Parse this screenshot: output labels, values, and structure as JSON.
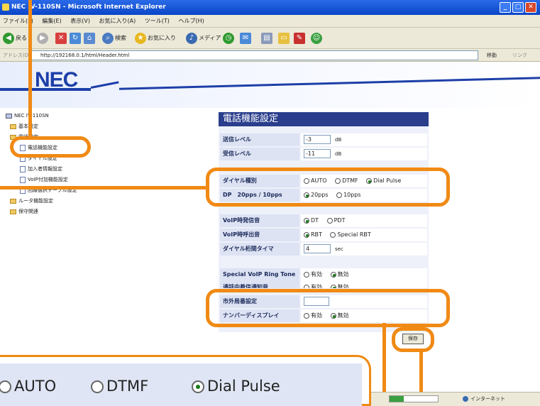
{
  "window": {
    "title": "NEC IV-110SN - Microsoft Internet Explorer",
    "minimize": "_",
    "maximize": "□",
    "close": "✕"
  },
  "menu": [
    "ファイル(F)",
    "編集(E)",
    "表示(V)",
    "お気に入り(A)",
    "ツール(T)",
    "ヘルプ(H)"
  ],
  "toolbar": {
    "back": "戻る",
    "search": "検索",
    "favorites": "お気に入り",
    "media": "メディア"
  },
  "address": {
    "label": "アドレス(D)",
    "url": "http://192168.0.1/html/Header.html",
    "go": "移動",
    "links": "リンク"
  },
  "brand": "NEC",
  "tree": [
    {
      "label": "NEC IV-110SN",
      "icon": "computer-icon"
    },
    {
      "label": "基本設定",
      "icon": "folder-icon"
    },
    {
      "label": "電話設定",
      "icon": "folder-icon"
    },
    {
      "label": "電話機能設定",
      "icon": "page-icon"
    },
    {
      "label": "ダイヤル設定",
      "icon": "page-icon"
    },
    {
      "label": "加入者情報設定",
      "icon": "page-icon"
    },
    {
      "label": "VoIP付加機能設定",
      "icon": "page-icon"
    },
    {
      "label": "回線選択テーブル設定",
      "icon": "page-icon"
    },
    {
      "label": "ルータ機能設定",
      "icon": "folder-icon"
    },
    {
      "label": "保守関連",
      "icon": "folder-icon"
    }
  ],
  "panel": {
    "title": "電話機能設定",
    "send_level": {
      "label": "送信レベル",
      "value": "-3",
      "unit": "dB"
    },
    "recv_level": {
      "label": "受信レベル",
      "value": "-11",
      "unit": "dB"
    },
    "dial_type": {
      "label": "ダイヤル種別",
      "options": [
        "AUTO",
        "DTMF",
        "Dial Pulse"
      ],
      "selected": "Dial Pulse"
    },
    "dp_speed": {
      "label": "DP　20pps / 10pps",
      "options": [
        "20pps",
        "10pps"
      ],
      "selected": "20pps"
    },
    "voip_dial_tone": {
      "label": "VoIP時発信音",
      "options": [
        "DT",
        "PDT"
      ],
      "selected": "DT"
    },
    "voip_ringback": {
      "label": "VoIP時呼出音",
      "options": [
        "RBT",
        "Special RBT"
      ],
      "selected": "RBT"
    },
    "dial_timer": {
      "label": "ダイヤル桁間タイマ",
      "value": "4",
      "unit": "sec"
    },
    "special_ring": {
      "label": "Special VoIP Ring Tone",
      "options": [
        "有効",
        "無効"
      ],
      "selected": "無効"
    },
    "call_notify": {
      "label": "通話中着信通知音",
      "options": [
        "有効",
        "無効"
      ],
      "selected": "無効"
    },
    "area_code": {
      "label": "市外局番設定",
      "value": ""
    },
    "number_display": {
      "label": "ナンバーディスプレイ",
      "options": [
        "有効",
        "無効"
      ],
      "selected": "無効"
    },
    "save": "保存"
  },
  "zoom": {
    "options": [
      "AUTO",
      "DTMF",
      "Dial Pulse"
    ],
    "selected": "Dial Pulse"
  },
  "status": {
    "zone": "インターネット"
  },
  "colors": {
    "accent": "#f08a14",
    "title_bar": "#0a46c8",
    "panel_title": "#2a3e8c",
    "brand": "#1d3fa8"
  }
}
